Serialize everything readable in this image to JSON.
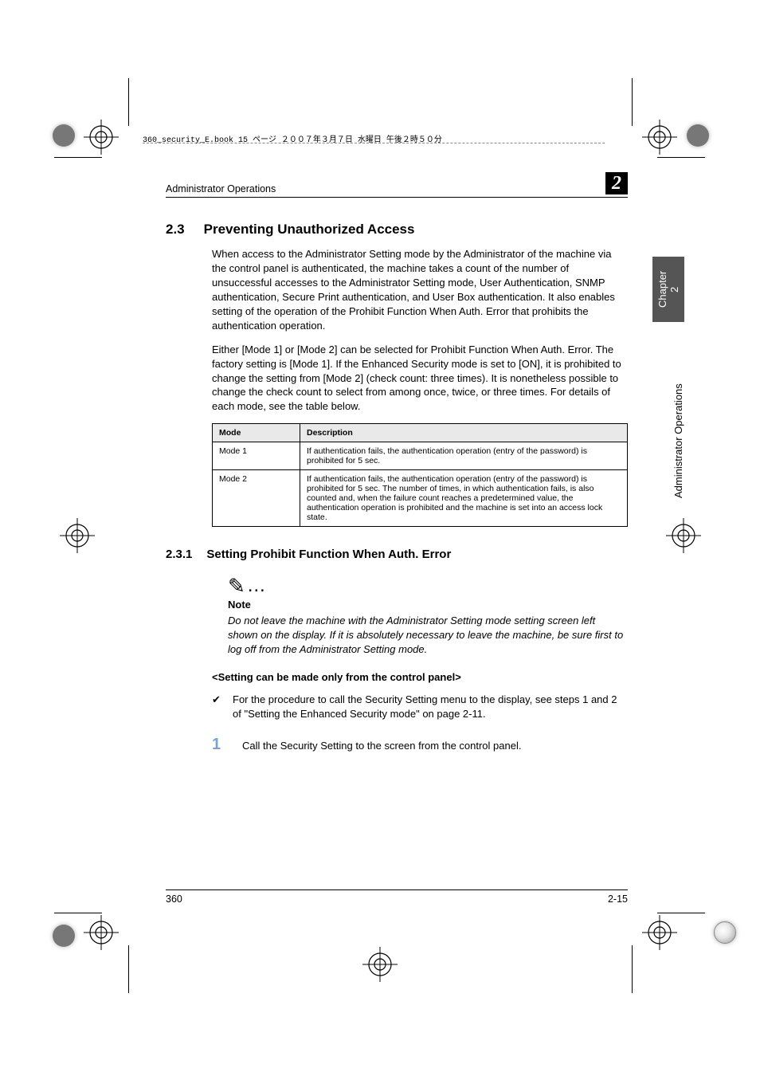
{
  "topline": "360_security_E.book 15 ページ ２００７年３月７日 水曜日 午後２時５０分",
  "header": {
    "section": "Administrator Operations",
    "chapter_num": "2"
  },
  "side": {
    "chapter_tab": "Chapter 2",
    "chapter_name": "Administrator Operations"
  },
  "h2": {
    "num": "2.3",
    "title": "Preventing Unauthorized Access"
  },
  "para1": "When access to the Administrator Setting mode by the Administrator of the machine via the control panel is authenticated, the machine takes a count of the number of unsuccessful accesses to the Administrator Setting mode, User Authentication, SNMP authentication, Secure Print authentication, and User Box authentication. It also enables setting of the operation of the Prohibit Function When Auth. Error that prohibits the authentication operation.",
  "para2": "Either [Mode 1] or [Mode 2] can be selected for Prohibit Function When Auth. Error. The factory setting is [Mode 1]. If the Enhanced Security mode is set to [ON], it is prohibited to change the setting from [Mode 2] (check count: three times). It is nonetheless possible to change the check count to select from among once, twice, or three times. For details of each mode, see the table below.",
  "table": {
    "headers": [
      "Mode",
      "Description"
    ],
    "rows": [
      [
        "Mode 1",
        "If authentication fails, the authentication operation (entry of the password) is prohibited for 5 sec."
      ],
      [
        "Mode 2",
        "If authentication fails, the authentication operation (entry of the password) is prohibited for 5 sec. The number of times, in which authentication fails, is also counted and, when the failure count reaches a predetermined value, the authentication operation is prohibited and the machine is set into an access lock state."
      ]
    ]
  },
  "h3": {
    "num": "2.3.1",
    "title": "Setting Prohibit Function When Auth. Error"
  },
  "note": {
    "heading": "Note",
    "body": "Do not leave the machine with the Administrator Setting mode setting screen left shown on the display. If it is absolutely necessary to leave the machine, be sure first to log off from the Administrator Setting mode."
  },
  "subheading": "<Setting can be made only from the control panel>",
  "check_text": "For the procedure to call the Security Setting menu to the display, see steps 1 and 2 of \"Setting the Enhanced Security mode\" on page 2-11.",
  "step": {
    "num": "1",
    "text": "Call the Security Setting to the screen from the control panel."
  },
  "footer": {
    "left": "360",
    "right": "2-15"
  }
}
